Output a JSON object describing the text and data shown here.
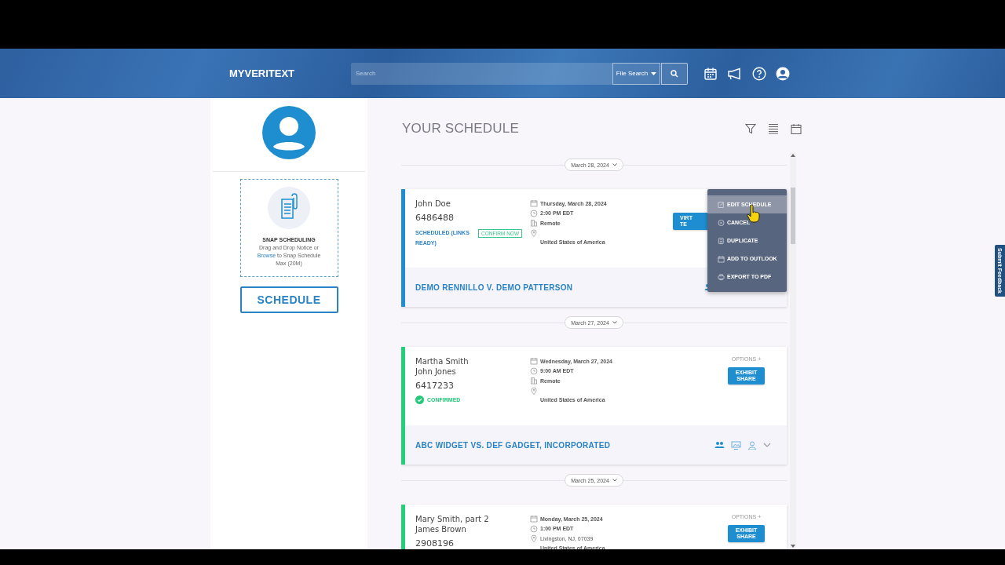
{
  "header": {
    "logo": "MYVERITEXT",
    "search_placeholder": "Search",
    "search_scope": "File Search"
  },
  "sidebar": {
    "snap_title": "SNAP SCHEDULING",
    "snap_text_before": "Drag and Drop Notice or",
    "snap_link": "Browse",
    "snap_text_after": "to Snap Schedule",
    "snap_limit": "Max (20M)",
    "schedule_button": "SCHEDULE"
  },
  "page_title": "YOUR SCHEDULE",
  "groups": [
    {
      "date": "March 28, 2024",
      "appointments": [
        {
          "names": [
            "John Doe"
          ],
          "job_number": "6486488",
          "color": "#1f8ed0",
          "status": {
            "kind": "scheduled",
            "label": "SCHEDULED (LINKS READY)",
            "action": "CONFIRM NOW"
          },
          "details": [
            {
              "kind": "date",
              "text": "Thursday, March 28, 2024"
            },
            {
              "kind": "time",
              "text": "2:00 PM EDT"
            },
            {
              "kind": "venue",
              "text": "Remote"
            },
            {
              "kind": "address"
            }
          ],
          "country": "United States of America",
          "button": {
            "kind": "wide",
            "lines": [
              "VIRT",
              "TE"
            ]
          },
          "case": "DEMO RENNILLO V. DEMO PATTERSON",
          "menu": {
            "items": [
              {
                "label": "EDIT SCHEDULE",
                "selected": true
              },
              {
                "label": "CANCEL",
                "selected": false
              },
              {
                "label": "DUPLICATE",
                "selected": false
              },
              {
                "label": "ADD TO OUTLOOK",
                "selected": false
              },
              {
                "label": "EXPORT TO PDF",
                "selected": false
              }
            ]
          }
        }
      ]
    },
    {
      "date": "March 27, 2024",
      "appointments": [
        {
          "names": [
            "Martha Smith",
            "John Jones"
          ],
          "job_number": "6417233",
          "color": "#22d07a",
          "status": {
            "kind": "confirmed",
            "label": "CONFIRMED"
          },
          "details": [
            {
              "kind": "date",
              "text": "Wednesday, March 27, 2024"
            },
            {
              "kind": "time",
              "text": "9:00 AM EDT"
            },
            {
              "kind": "venue",
              "text": "Remote"
            },
            {
              "kind": "address"
            }
          ],
          "country": "United States of America",
          "options": "OPTIONS +",
          "button": {
            "kind": "normal",
            "lines": [
              "EXHIBIT",
              "SHARE"
            ]
          },
          "case": "ABC WIDGET VS. DEF GADGET, INCORPORATED"
        }
      ]
    },
    {
      "date": "March 25, 2024",
      "appointments": [
        {
          "names": [
            "Mary Smith, part 2",
            "James Brown"
          ],
          "job_number": "2908196",
          "color": "#22d07a",
          "details": [
            {
              "kind": "date",
              "text": "Monday, March 25, 2024"
            },
            {
              "kind": "time",
              "text": "1:00 PM EDT"
            },
            {
              "kind": "address",
              "text": "Livingston, NJ, 07039"
            }
          ],
          "country": "United States of America",
          "options": "OPTIONS +",
          "button": {
            "kind": "normal",
            "lines": [
              "EXHIBIT",
              "SHARE"
            ]
          }
        }
      ]
    }
  ],
  "feedback_tab": "Submit Feedback"
}
